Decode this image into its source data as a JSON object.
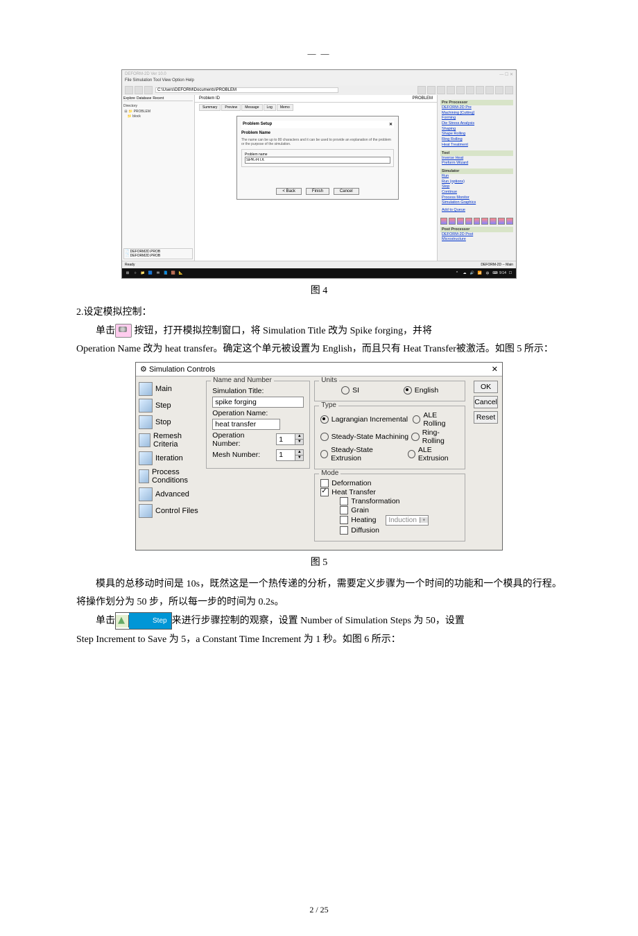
{
  "dashTop": "— —",
  "fig1": {
    "appTitle": "DEFORM-2D  Ver 10.0",
    "menu": "File  Simulation  Tool  View  Option  Help",
    "path": "C:\\Users\\DEFORM\\Documents\\PROBLEM",
    "leftTabs": [
      "Explore",
      "Database",
      "Recent"
    ],
    "tree": [
      "Directory",
      "PROBLEM",
      "block"
    ],
    "problemId": "Problem ID",
    "problemCode": "PROBLEM",
    "centerTabs": [
      "Summary",
      "Preview",
      "Message",
      "Log",
      "Memo"
    ],
    "dlg": {
      "title": "Problem Setup",
      "sub": "Problem Name",
      "helptext": "The name can be up to 80 characters and it can be used to provide an explanation of the problem or the purpose of the simulation.",
      "fieldLabel": "Problem name",
      "value": "SPK-HTX",
      "back": "< Back",
      "finish": "Finish",
      "cancel": "Cancel"
    },
    "pre": {
      "title": "Pre Processor",
      "links": [
        "DEFORM-2D Pre",
        "Machining [Cutting]",
        "Forming",
        "Die Stress Analysis",
        "Shaping",
        "Shape Rolling",
        "Ring Rolling",
        "Heat Treatment"
      ]
    },
    "tool": {
      "title": "Tool",
      "links": [
        "Inverse Heat",
        "Preform Wizard"
      ]
    },
    "simu": {
      "title": "Simulator",
      "links": [
        "Run",
        "Run (options)",
        "Stop",
        "Continue",
        "Process Monitor",
        "Simulation Graphics",
        "",
        "Add to Queue"
      ]
    },
    "post": {
      "title": "Post Processor",
      "links": [
        "DEFORM-2D Post",
        "Microstructure"
      ]
    },
    "status": "Ready",
    "statusRight": "DEFORM-2D -- Main",
    "taskTime": "9:14"
  },
  "caption1": "图  4",
  "sec2": "2.设定模拟控制：",
  "para1a": "单击",
  "para1b": "  按钮，打开模拟控制窗口，将 Simulation  Title 改为 Spike  forging，并将",
  "para2": "Operation Name 改为 heat transfer。确定这个单元被设置为 English，而且只有 Heat Transfer被激活。如图 5 所示：",
  "sim": {
    "title": "Simulation Controls",
    "nav": [
      "Main",
      "Step",
      "Stop",
      "Remesh Criteria",
      "Iteration",
      "Process Conditions",
      "Advanced",
      "Control Files"
    ],
    "nameNumber": "Name and Number",
    "simTitleLbl": "Simulation Title:",
    "simTitleVal": "spike forging",
    "opNameLbl": "Operation Name:",
    "opNameVal": "heat transfer",
    "opNumLbl": "Operation Number:",
    "opNumVal": "1",
    "meshLbl": "Mesh Number:",
    "meshVal": "1",
    "units": "Units",
    "si": "SI",
    "english": "English",
    "type": "Type",
    "typeOpts": [
      [
        "Lagrangian Incremental",
        true,
        "ALE Rolling",
        false
      ],
      [
        "Steady-State Machining",
        false,
        "Ring-Rolling",
        false
      ],
      [
        "Steady-State Extrusion",
        false,
        "ALE Extrusion",
        false
      ]
    ],
    "mode": "Mode",
    "deformation": "Deformation",
    "heatTransfer": "Heat Transfer",
    "transformation": "Transformation",
    "grain": "Grain",
    "heating": "Heating",
    "induction": "Induction",
    "diffusion": "Diffusion",
    "ok": "OK",
    "cancel": "Cancel",
    "reset": "Reset"
  },
  "caption2": "图  5",
  "para3": "模具的总移动时间是 10s，既然这是一个热传递的分析，需要定义步骤为一个时间的功能和一个模具的行程。将操作划分为 50 步，所以每一步的时间为 0.2s。",
  "para4a": "单击",
  "stepLabel": "Step",
  "para4b": "来进行步骤控制的观察，设置 Number  of  Simulation  Steps 为 50，设置",
  "para5": "Step Increment to Save 为 5，a Constant Time Increment 为 1 秒。如图 6 所示：",
  "pageNum": "2  / 25"
}
